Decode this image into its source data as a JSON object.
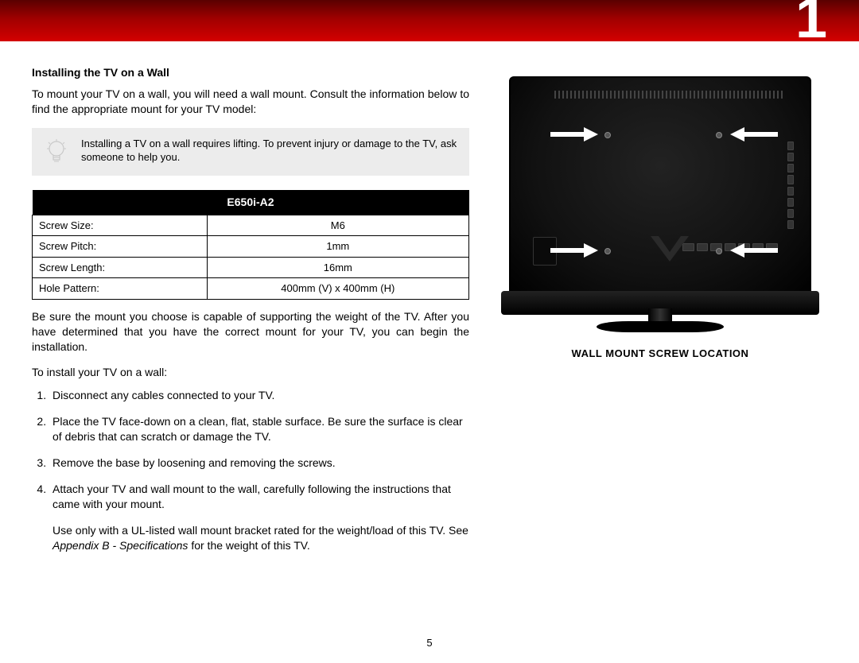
{
  "chapter_number": "1",
  "page_number": "5",
  "left": {
    "section_title": "Installing the TV on a Wall",
    "intro": "To mount your TV on a wall, you will need a wall mount. Consult the information below to find the appropriate mount for your TV model:",
    "callout": "Installing a TV on a wall requires lifting. To prevent injury or damage to the TV, ask someone to help you.",
    "table_header": "E650i-A2",
    "specs": [
      {
        "label": "Screw Size:",
        "value": "M6"
      },
      {
        "label": "Screw Pitch:",
        "value": "1mm"
      },
      {
        "label": "Screw Length:",
        "value": "16mm"
      },
      {
        "label": "Hole Pattern:",
        "value": "400mm (V) x 400mm (H)"
      }
    ],
    "para_after_table": "Be sure the mount you choose is capable of supporting the weight of the TV. After you have determined that you have the correct mount for your TV, you can begin the installation.",
    "lead_in": "To install your TV on a wall:",
    "steps": [
      "Disconnect any cables connected to your TV.",
      "Place the TV face-down on a clean, flat, stable surface. Be sure the surface is clear of debris that can scratch or damage the TV.",
      "Remove the base by loosening and removing the screws.",
      "Attach your TV and wall mount to the wall, carefully following the instructions that came with your mount."
    ],
    "step4_extra_pre": "Use only with a UL-listed wall mount bracket rated for the weight/load of this TV. See ",
    "step4_extra_em": "Appendix B - Specifications",
    "step4_extra_post": " for the weight of this TV."
  },
  "right": {
    "caption": "WALL MOUNT SCREW LOCATION"
  }
}
